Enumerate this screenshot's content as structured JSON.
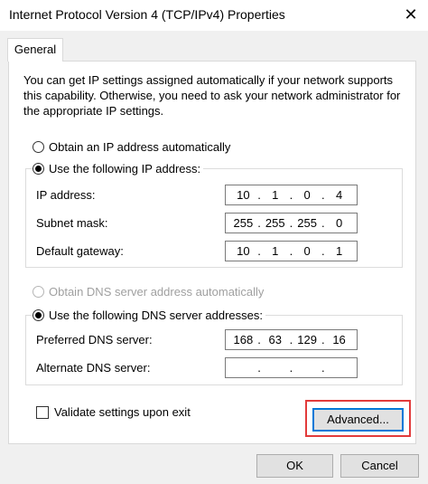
{
  "window": {
    "title": "Internet Protocol Version 4 (TCP/IPv4) Properties",
    "close_glyph": "✕"
  },
  "tabs": [
    {
      "label": "General",
      "selected": true
    }
  ],
  "description": "You can get IP settings assigned automatically if your network supports this capability. Otherwise, you need to ask your network administrator for the appropriate IP settings.",
  "ip_section": {
    "auto_option": {
      "label": "Obtain an IP address automatically",
      "checked": false
    },
    "manual_option": {
      "label": "Use the following IP address:",
      "checked": true
    },
    "fields": {
      "ip_address": {
        "label": "IP address:",
        "octets": [
          "10",
          "1",
          "0",
          "4"
        ]
      },
      "subnet_mask": {
        "label": "Subnet mask:",
        "octets": [
          "255",
          "255",
          "255",
          "0"
        ]
      },
      "default_gateway": {
        "label": "Default gateway:",
        "octets": [
          "10",
          "1",
          "0",
          "1"
        ]
      }
    }
  },
  "dns_section": {
    "auto_option": {
      "label": "Obtain DNS server address automatically",
      "checked": false,
      "enabled": false
    },
    "manual_option": {
      "label": "Use the following DNS server addresses:",
      "checked": true
    },
    "fields": {
      "preferred": {
        "label": "Preferred DNS server:",
        "octets": [
          "168",
          "63",
          "129",
          "16"
        ]
      },
      "alternate": {
        "label": "Alternate DNS server:",
        "octets": [
          "",
          "",
          "",
          ""
        ]
      }
    }
  },
  "validate_checkbox": {
    "label": "Validate settings upon exit",
    "checked": false
  },
  "buttons": {
    "advanced": "Advanced...",
    "ok": "OK",
    "cancel": "Cancel"
  },
  "colors": {
    "highlight": "#e23b3b",
    "focus": "#0078d7"
  }
}
